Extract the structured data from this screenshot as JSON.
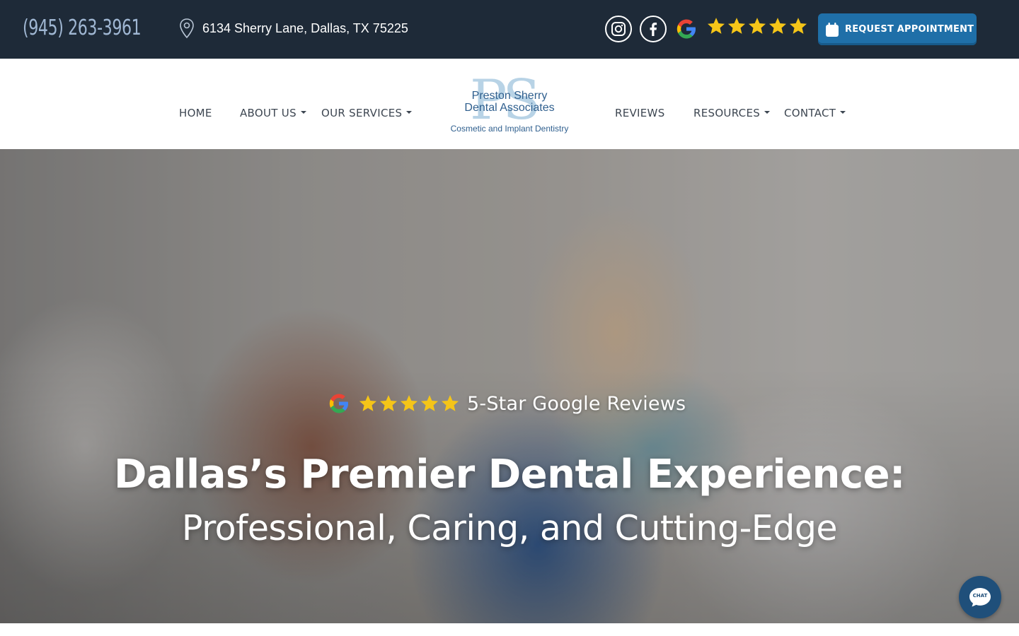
{
  "topbar": {
    "phone": "(945) 263-3961",
    "address": "6134 Sherry Lane, Dallas, TX 75225",
    "social_icons": [
      "instagram-icon",
      "facebook-icon",
      "google-icon"
    ],
    "rating_stars": 5,
    "request_button": "REQUEST APPOINTMENT",
    "colors": {
      "background": "#1e2a38",
      "button": "#1f6fa8",
      "phone": "#9fb6d2",
      "star": "#f5c518"
    }
  },
  "nav": {
    "items": [
      {
        "label": "HOME",
        "has_dropdown": false
      },
      {
        "label": "ABOUT US",
        "has_dropdown": true
      },
      {
        "label": "OUR SERVICES",
        "has_dropdown": true
      },
      {
        "label": "REVIEWS",
        "has_dropdown": false
      },
      {
        "label": "RESOURCES",
        "has_dropdown": true
      },
      {
        "label": "CONTACT",
        "has_dropdown": true
      }
    ],
    "logo": {
      "monogram": "PS",
      "line1": "Preston Sherry",
      "line2": "Dental Associates",
      "tagline": "Cosmetic and Implant Dentistry"
    }
  },
  "hero": {
    "review_badge": "5-Star Google Reviews",
    "review_stars": 5,
    "headline": "Dallas’s Premier Dental Experience:",
    "subheadline": "Professional, Caring, and Cutting-Edge"
  },
  "chat": {
    "label": "CHAT"
  }
}
